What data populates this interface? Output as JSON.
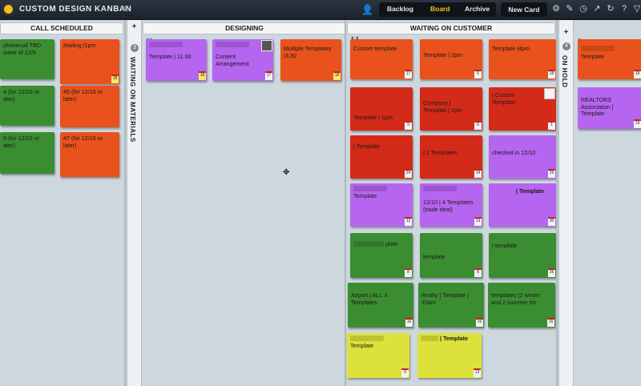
{
  "header": {
    "app_title": "CUSTOM DESIGN KANBAN",
    "nav": [
      {
        "label": "Backlog"
      },
      {
        "label": "Board"
      },
      {
        "label": "Archive"
      }
    ],
    "active_tab": "Board",
    "new_card_label": "New Card"
  },
  "columns": {
    "call_scheduled": "CALL SCHEDULED",
    "designing": "DESIGNING",
    "waiting_on_customer": "WAITING ON CUSTOMER",
    "waiting_on_materials": "WAITING ON MATERIALS",
    "waiting_on_materials_count": "3",
    "on_hold": "ON HOLD",
    "on_hold_count": "4",
    "plus": "+",
    "ctl": "◂  ▸",
    "pause": "❚❚",
    "ctl_arrow": "▸"
  },
  "cards": {
    "cs1": "phonecall TBD\nweek of 12/9",
    "cs2": "Mailing |1pm",
    "cs3": "4 (for 12/16 or\nater)",
    "cs4": "#5 (for 12/16 or\nlater)",
    "cs5": "5 (for 12/16 or\nater)",
    "cs6": "#7 (for 12/16 or\nlater)",
    "cs2_badge": "18",
    "d1": "Template | 11:30",
    "d1_badge": "18",
    "d2": "Content\nArrangement",
    "d2_badge": "17",
    "d3": "Multiple Templates\n|3:30",
    "d3_badge": "18",
    "w1": "Custom template",
    "w1_badge": "17",
    "w2": "Template | 2pm",
    "w2_badge": "6",
    "w3": "Template |4pm",
    "w3_badge": "18",
    "w4": "Template | 1pm",
    "w4_badge": "9",
    "w5": "Company |\nTemplate | 1pm",
    "w5_badge": "6",
    "w6": "| Custom\nTemplate",
    "w6_badge": "1",
    "w7": "| Template",
    "w7_badge": "24",
    "w8": "| 2 Templates",
    "w8_badge": "14",
    "w9": "checked in 12/10",
    "w9_badge": "29",
    "w10": "Template",
    "w10_badge": "12",
    "w11": "12/10 | 4 Templates\n(trade deal)",
    "w11_badge": "13",
    "w12": "| Template",
    "w12_badge": "30",
    "w13": "plate",
    "w13_badge": "8",
    "w14": "template",
    "w14_badge": "8",
    "w15": "| template",
    "w15_badge": "26",
    "w16": "Airport | ALL 3\nTemplates",
    "w16_badge": "16",
    "w17": "Realty | Template |\n10am",
    "w17_badge": "16",
    "w18": "templates (2 winter\nand 2 summer for",
    "w18_badge": "16",
    "w19": "Template",
    "w19_badge": "9",
    "w20": "| Template",
    "w20_badge": "13",
    "h1": "Template",
    "h1_badge": "18",
    "h2": "REALTORS\nAssociation |\nTemplate",
    "h2_badge": "19"
  }
}
